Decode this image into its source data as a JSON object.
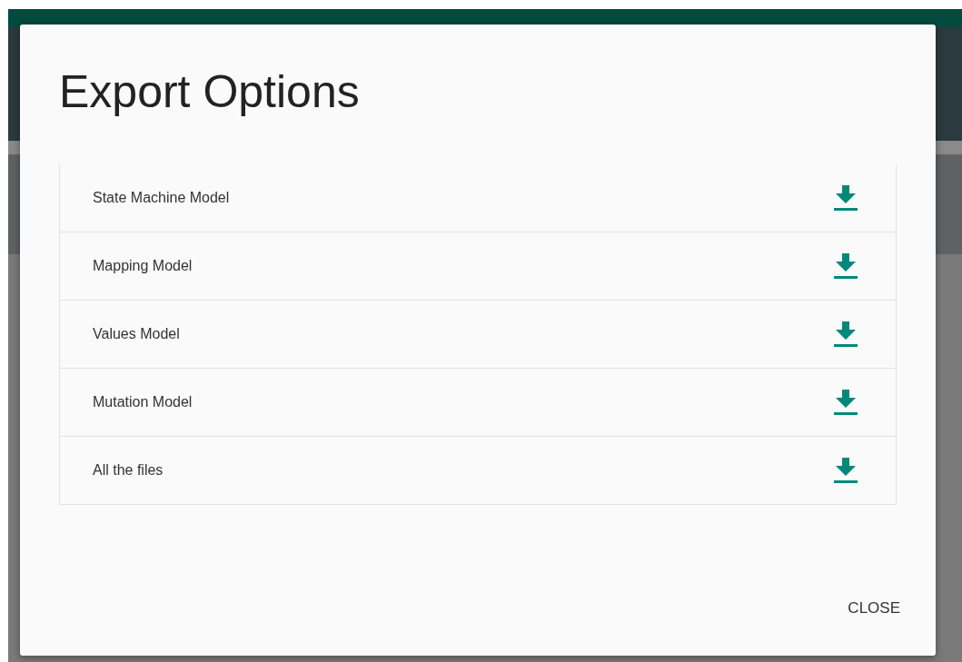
{
  "dialog": {
    "title": "Export Options",
    "items": [
      {
        "label": "State Machine Model"
      },
      {
        "label": "Mapping Model"
      },
      {
        "label": "Values Model"
      },
      {
        "label": "Mutation Model"
      },
      {
        "label": "All the files"
      }
    ],
    "buttons": [
      "CLOSE"
    ]
  }
}
